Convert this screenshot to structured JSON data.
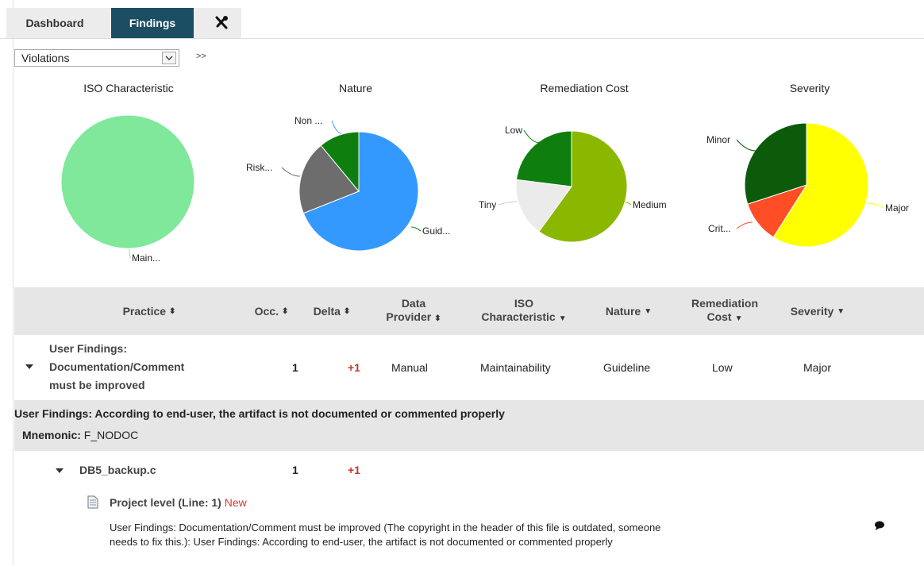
{
  "tabs": {
    "dashboard": "Dashboard",
    "findings": "Findings",
    "tools_icon": "wrench-cross-icon"
  },
  "filter": {
    "selected": "Violations",
    "more": ">>"
  },
  "charts": [
    {
      "title": "ISO Characteristic",
      "labels": [
        "Main..."
      ]
    },
    {
      "title": "Nature",
      "labels": [
        "Guid...",
        "Risk...",
        "Non ..."
      ]
    },
    {
      "title": "Remediation Cost",
      "labels": [
        "Low",
        "Tiny",
        "Medium"
      ]
    },
    {
      "title": "Severity",
      "labels": [
        "Minor",
        "Major",
        "Crit..."
      ]
    }
  ],
  "chart_data": [
    {
      "type": "pie",
      "title": "ISO Characteristic",
      "slices": [
        {
          "label": "Main...",
          "value": 100,
          "color": "#7fe89a"
        }
      ]
    },
    {
      "type": "pie",
      "title": "Nature",
      "slices": [
        {
          "label": "Non ...",
          "value": 69,
          "color": "#3399ff"
        },
        {
          "label": "Risk...",
          "value": 20,
          "color": "#6d6d6d"
        },
        {
          "label": "Guid...",
          "value": 11,
          "color": "#0e7e0e"
        }
      ]
    },
    {
      "type": "pie",
      "title": "Remediation Cost",
      "slices": [
        {
          "label": "Medium",
          "value": 60,
          "color": "#8ab800"
        },
        {
          "label": "Tiny",
          "value": 17,
          "color": "#ebebeb"
        },
        {
          "label": "Low",
          "value": 23,
          "color": "#0e7e0e"
        }
      ]
    },
    {
      "type": "pie",
      "title": "Severity",
      "slices": [
        {
          "label": "Major",
          "value": 59,
          "color": "#ffff00"
        },
        {
          "label": "Crit...",
          "value": 11,
          "color": "#ff4d26"
        },
        {
          "label": "Minor",
          "value": 30,
          "color": "#0b5b0b"
        }
      ]
    }
  ],
  "table": {
    "headers": {
      "practice": "Practice",
      "occ": "Occ.",
      "delta": "Delta",
      "data_provider_1": "Data",
      "data_provider_2": "Provider",
      "iso_1": "ISO",
      "iso_2": "Characteristic",
      "nature": "Nature",
      "remediation_1": "Remediation",
      "remediation_2": "Cost",
      "severity": "Severity"
    },
    "row": {
      "practice_1": "User Findings:",
      "practice_2": "Documentation/Comment",
      "practice_3": "must be improved",
      "occ": "1",
      "delta": "+1",
      "data_provider": "Manual",
      "iso": "Maintainability",
      "nature": "Guideline",
      "remediation": "Low",
      "severity": "Major"
    },
    "description": "User Findings: According to end-user, the artifact is not documented or commented properly",
    "mnemonic_label": "Mnemonic:",
    "mnemonic_value": "F_NODOC",
    "file": {
      "name": "DB5_backup.c",
      "occ": "1",
      "delta": "+1"
    },
    "location": {
      "label": "Project level (Line: 1)",
      "status": "New"
    },
    "message_1": "User Findings: Documentation/Comment must be improved (The copyright in the header of this file is outdated, someone",
    "message_2": "needs to fix this.): User Findings: According to end-user, the artifact is not documented or commented properly"
  }
}
